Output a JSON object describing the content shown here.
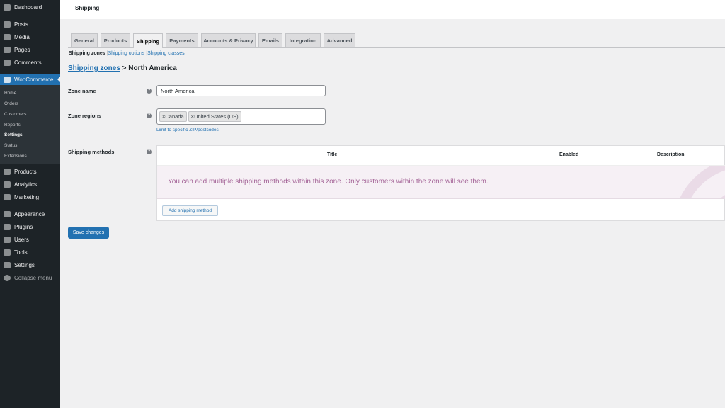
{
  "sidebar": {
    "items": [
      "Dashboard",
      "Posts",
      "Media",
      "Pages",
      "Comments",
      "WooCommerce",
      "Products",
      "Analytics",
      "Marketing",
      "Appearance",
      "Plugins",
      "Users",
      "Tools",
      "Settings",
      "Collapse menu"
    ],
    "submenu": [
      "Home",
      "Orders",
      "Customers",
      "Reports",
      "Settings",
      "Status",
      "Extensions"
    ]
  },
  "header": {
    "title": "Shipping"
  },
  "tabs": [
    "General",
    "Products",
    "Shipping",
    "Payments",
    "Accounts & Privacy",
    "Emails",
    "Integration",
    "Advanced"
  ],
  "subnav": {
    "current": "Shipping zones",
    "options": "Shipping options",
    "classes": "Shipping classes"
  },
  "breadcrumb": {
    "link": "Shipping zones",
    "sep": ">",
    "current": "North America"
  },
  "form": {
    "zone_name_label": "Zone name",
    "zone_name_value": "North America",
    "zone_regions_label": "Zone regions",
    "regions": [
      "Canada",
      "United States (US)"
    ],
    "limit_link": "Limit to specific ZIP/postcodes",
    "methods_label": "Shipping methods"
  },
  "table": {
    "title": "Title",
    "enabled": "Enabled",
    "description": "Description",
    "blank": "You can add multiple shipping methods within this zone. Only customers within the zone will see them.",
    "add": "Add shipping method"
  },
  "save": "Save changes",
  "colors": {
    "accent": "#2271b1",
    "woo": "#96588a"
  }
}
